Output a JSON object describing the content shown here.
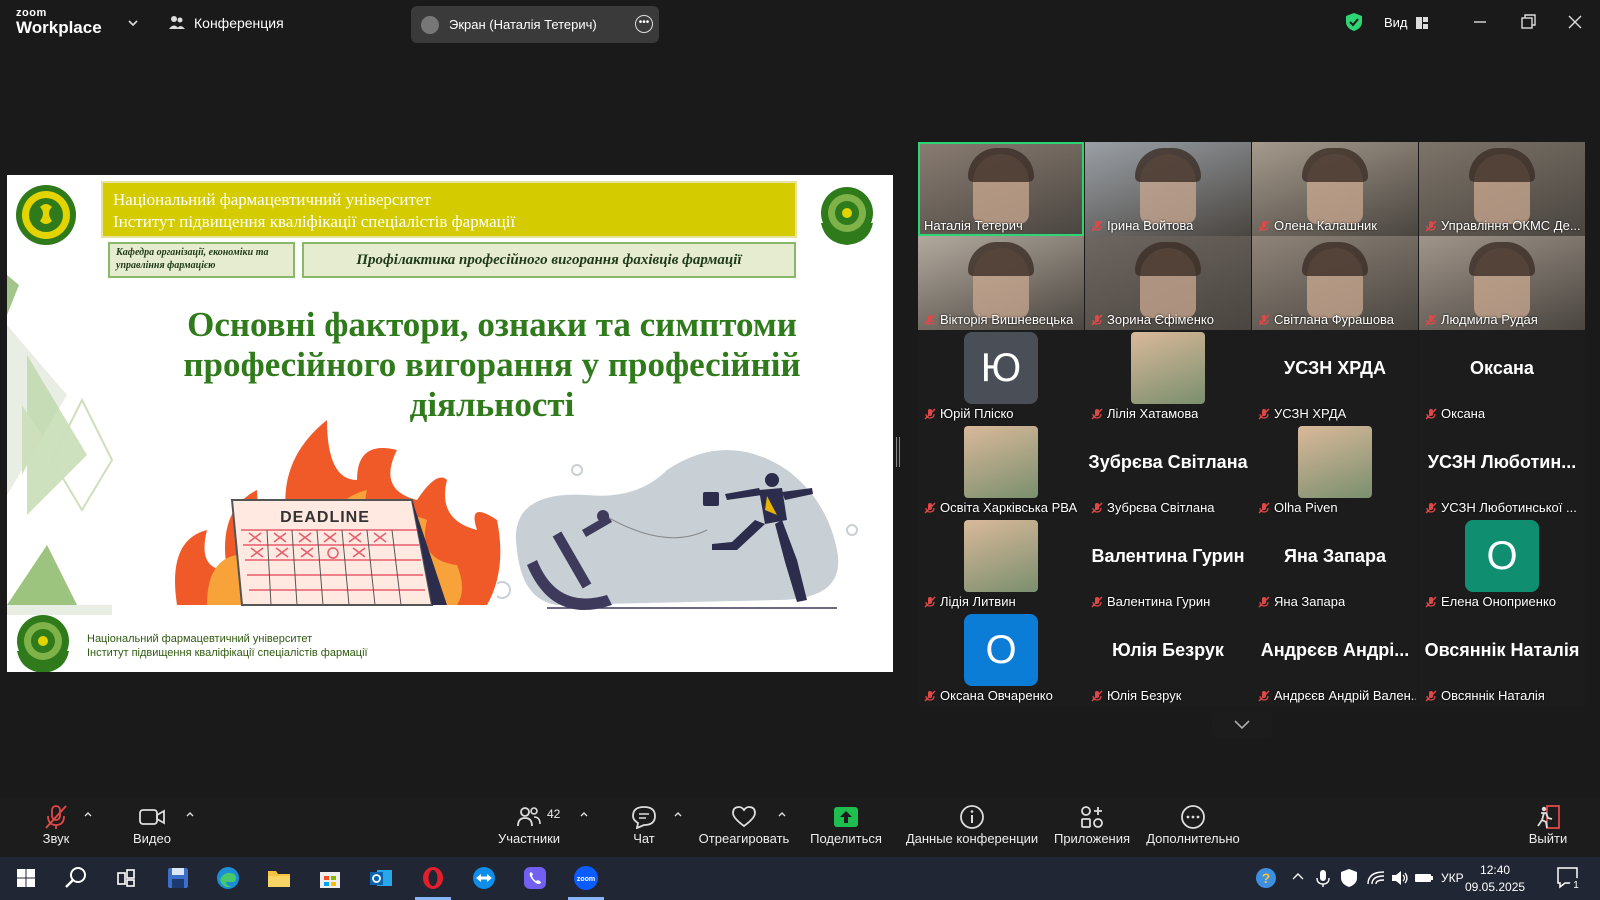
{
  "topbar": {
    "logo_line1": "zoom",
    "logo_line2": "Workplace",
    "conference_label": "Конференция",
    "screen_share_label": "Экран (Наталія Тетерич)",
    "view_label": "Вид",
    "secure_color": "#2ed573"
  },
  "slide": {
    "university_line1": "Національний фармацевтичний університет",
    "university_line2": "Інститут підвищення кваліфікації спеціалістів фармації",
    "department": "Кафедра організації, економіки та управління фармацією",
    "topic": "Профілактика професійного вигорання фахівців фармації",
    "heading_line1": "Основні фактори, ознаки та симптоми",
    "heading_line2": "професійного вигорання у професійній",
    "heading_line3": "діяльності",
    "deadline_label": "DEADLINE",
    "footer_line1": "Національний фармацевтичний університет",
    "footer_line2": "Інститут підвищення кваліфікації спеціалістів фармації"
  },
  "participants": [
    {
      "name": "Наталія Тетерич",
      "kind": "video",
      "active": true,
      "muted": false
    },
    {
      "name": "Ірина Войтова",
      "kind": "video",
      "muted": true
    },
    {
      "name": "Олена Калашник",
      "kind": "video",
      "muted": true
    },
    {
      "name": "Управління ОКМС Де...",
      "kind": "video",
      "muted": true
    },
    {
      "name": "Вікторія Вишневецька",
      "kind": "video",
      "muted": true
    },
    {
      "name": "Зорина  Єфіменко",
      "kind": "video",
      "muted": true
    },
    {
      "name": "Світлана Фурашова",
      "kind": "video",
      "muted": true
    },
    {
      "name": "Людмила Рудая",
      "kind": "video",
      "muted": true
    },
    {
      "name": "Юрій Пліско",
      "kind": "avatar",
      "initial": "Ю",
      "avatar_color": "#4a4f57",
      "muted": true
    },
    {
      "name": "Лілія Хатамова",
      "kind": "photo",
      "muted": true
    },
    {
      "name": "УСЗН ХРДА",
      "kind": "text",
      "big": "УСЗН ХРДА",
      "muted": true
    },
    {
      "name": "Оксана",
      "kind": "text",
      "big": "Оксана",
      "muted": true
    },
    {
      "name": "Освіта Харківська РВА",
      "kind": "photo",
      "muted": true
    },
    {
      "name": "Зубрєва Світлана",
      "kind": "text",
      "big": "Зубрєва Світлана",
      "muted": true
    },
    {
      "name": "Olha Piven",
      "kind": "photo",
      "muted": true
    },
    {
      "name": "УСЗН Люботинської ...",
      "kind": "text",
      "big": "УСЗН Люботин...",
      "muted": true
    },
    {
      "name": "Лідія Литвин",
      "kind": "photo",
      "muted": true
    },
    {
      "name": "Валентина Гурин",
      "kind": "text",
      "big": "Валентина Гурин",
      "muted": true
    },
    {
      "name": "Яна Запара",
      "kind": "text",
      "big": "Яна Запара",
      "muted": true
    },
    {
      "name": "Елена Оноприенко",
      "kind": "avatar",
      "initial": "О",
      "avatar_color": "#0f8f6f",
      "muted": true
    },
    {
      "name": "Оксана Овчаренко",
      "kind": "avatar",
      "initial": "О",
      "avatar_color": "#0b7dd6",
      "muted": true
    },
    {
      "name": "Юлія Безрук",
      "kind": "text",
      "big": "Юлія Безрук",
      "muted": true
    },
    {
      "name": "Андрєєв Андрій Вален...",
      "kind": "text",
      "big": "Андрєєв Андрі...",
      "muted": true
    },
    {
      "name": "Овсяннік Наталія",
      "kind": "text",
      "big": "Овсяннік Наталія",
      "muted": true
    }
  ],
  "toolbar": {
    "audio": "Звук",
    "video": "Видео",
    "participants": "Участники",
    "participants_count": "42",
    "chat": "Чат",
    "react": "Отреагировать",
    "share": "Поделиться",
    "share_color": "#1fbf4f",
    "info": "Данные конференции",
    "apps": "Приложения",
    "more": "Дополнительно",
    "leave": "Выйти"
  },
  "taskbar": {
    "language": "УКР",
    "time": "12:40",
    "date": "09.05.2025",
    "notifications": "1"
  }
}
